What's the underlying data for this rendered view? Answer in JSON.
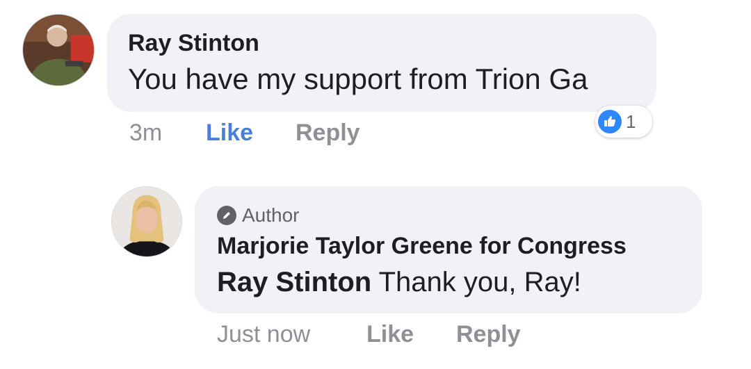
{
  "comment": {
    "author_name": "Ray Stinton",
    "text": "You have my support from Trion Ga",
    "time": "3m",
    "like_label": "Like",
    "reply_label": "Reply",
    "reaction_icon": "thumbs-up-icon",
    "reaction_count": "1",
    "like_color": "#4a7fd8"
  },
  "reply": {
    "badge_icon": "pencil-icon",
    "badge_label": "Author",
    "author_name": "Marjorie Taylor Greene for Congress",
    "mention": "Ray Stinton",
    "text": "Thank you, Ray!",
    "time": "Just now",
    "like_label": "Like",
    "reply_label": "Reply"
  },
  "colors": {
    "bubble_bg": "#f0f2f5",
    "meta_text": "#8e9095",
    "reaction_blue": "#2d88ff"
  }
}
